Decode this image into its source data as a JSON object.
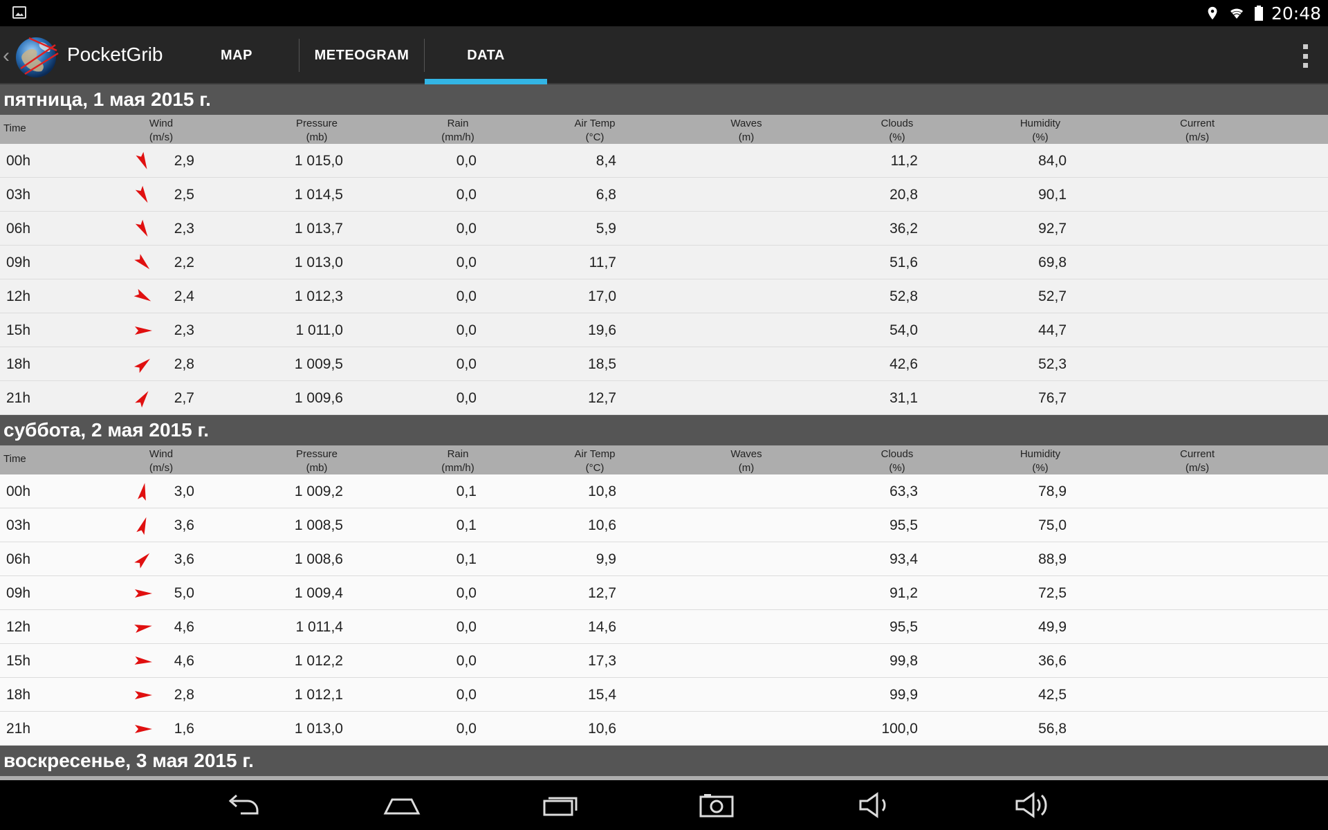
{
  "status_bar": {
    "time": "20:48",
    "icons": [
      "image-icon",
      "location-icon",
      "wifi-icon",
      "battery-icon"
    ]
  },
  "action_bar": {
    "app_title": "PocketGrib",
    "tabs": [
      {
        "label": "MAP",
        "active": false
      },
      {
        "label": "METEOGRAM",
        "active": false
      },
      {
        "label": "DATA",
        "active": true
      }
    ],
    "accent_color": "#33b5e5"
  },
  "columns": {
    "time": "Time",
    "wind": {
      "name": "Wind",
      "unit": "(m/s)"
    },
    "pressure": {
      "name": "Pressure",
      "unit": "(mb)"
    },
    "rain": {
      "name": "Rain",
      "unit": "(mm/h)"
    },
    "air_temp": {
      "name": "Air Temp",
      "unit": "(°C)"
    },
    "waves": {
      "name": "Waves",
      "unit": "(m)"
    },
    "clouds": {
      "name": "Clouds",
      "unit": "(%)"
    },
    "humidity": {
      "name": "Humidity",
      "unit": "(%)"
    },
    "current": {
      "name": "Current",
      "unit": "(m/s)"
    }
  },
  "days": [
    {
      "title": "пятница, 1 мая 2015 г.",
      "rows": [
        {
          "time": "00h",
          "wind_dir": 155,
          "wind": "2,9",
          "pressure": "1 015,0",
          "rain": "0,0",
          "air_temp": "8,4",
          "clouds": "11,2",
          "humidity": "84,0"
        },
        {
          "time": "03h",
          "wind_dir": 150,
          "wind": "2,5",
          "pressure": "1 014,5",
          "rain": "0,0",
          "air_temp": "6,8",
          "clouds": "20,8",
          "humidity": "90,1"
        },
        {
          "time": "06h",
          "wind_dir": 150,
          "wind": "2,3",
          "pressure": "1 013,7",
          "rain": "0,0",
          "air_temp": "5,9",
          "clouds": "36,2",
          "humidity": "92,7"
        },
        {
          "time": "09h",
          "wind_dir": 135,
          "wind": "2,2",
          "pressure": "1 013,0",
          "rain": "0,0",
          "air_temp": "11,7",
          "clouds": "51,6",
          "humidity": "69,8"
        },
        {
          "time": "12h",
          "wind_dir": 120,
          "wind": "2,4",
          "pressure": "1 012,3",
          "rain": "0,0",
          "air_temp": "17,0",
          "clouds": "52,8",
          "humidity": "52,7"
        },
        {
          "time": "15h",
          "wind_dir": 90,
          "wind": "2,3",
          "pressure": "1 011,0",
          "rain": "0,0",
          "air_temp": "19,6",
          "clouds": "54,0",
          "humidity": "44,7"
        },
        {
          "time": "18h",
          "wind_dir": 50,
          "wind": "2,8",
          "pressure": "1 009,5",
          "rain": "0,0",
          "air_temp": "18,5",
          "clouds": "42,6",
          "humidity": "52,3"
        },
        {
          "time": "21h",
          "wind_dir": 35,
          "wind": "2,7",
          "pressure": "1 009,6",
          "rain": "0,0",
          "air_temp": "12,7",
          "clouds": "31,1",
          "humidity": "76,7"
        }
      ]
    },
    {
      "title": "суббота, 2 мая 2015 г.",
      "rows": [
        {
          "time": "00h",
          "wind_dir": 10,
          "wind": "3,0",
          "pressure": "1 009,2",
          "rain": "0,1",
          "air_temp": "10,8",
          "clouds": "63,3",
          "humidity": "78,9"
        },
        {
          "time": "03h",
          "wind_dir": 20,
          "wind": "3,6",
          "pressure": "1 008,5",
          "rain": "0,1",
          "air_temp": "10,6",
          "clouds": "95,5",
          "humidity": "75,0"
        },
        {
          "time": "06h",
          "wind_dir": 45,
          "wind": "3,6",
          "pressure": "1 008,6",
          "rain": "0,1",
          "air_temp": "9,9",
          "clouds": "93,4",
          "humidity": "88,9"
        },
        {
          "time": "09h",
          "wind_dir": 90,
          "wind": "5,0",
          "pressure": "1 009,4",
          "rain": "0,0",
          "air_temp": "12,7",
          "clouds": "91,2",
          "humidity": "72,5"
        },
        {
          "time": "12h",
          "wind_dir": 80,
          "wind": "4,6",
          "pressure": "1 011,4",
          "rain": "0,0",
          "air_temp": "14,6",
          "clouds": "95,5",
          "humidity": "49,9"
        },
        {
          "time": "15h",
          "wind_dir": 95,
          "wind": "4,6",
          "pressure": "1 012,2",
          "rain": "0,0",
          "air_temp": "17,3",
          "clouds": "99,8",
          "humidity": "36,6"
        },
        {
          "time": "18h",
          "wind_dir": 90,
          "wind": "2,8",
          "pressure": "1 012,1",
          "rain": "0,0",
          "air_temp": "15,4",
          "clouds": "99,9",
          "humidity": "42,5"
        },
        {
          "time": "21h",
          "wind_dir": 90,
          "wind": "1,6",
          "pressure": "1 013,0",
          "rain": "0,0",
          "air_temp": "10,6",
          "clouds": "100,0",
          "humidity": "56,8"
        }
      ]
    },
    {
      "title": "воскресенье, 3 мая 2015 г.",
      "rows": []
    }
  ],
  "nav_bar": {
    "icons": [
      "back-icon",
      "home-icon",
      "recents-icon",
      "screenshot-icon",
      "volume-down-icon",
      "volume-up-icon"
    ]
  }
}
